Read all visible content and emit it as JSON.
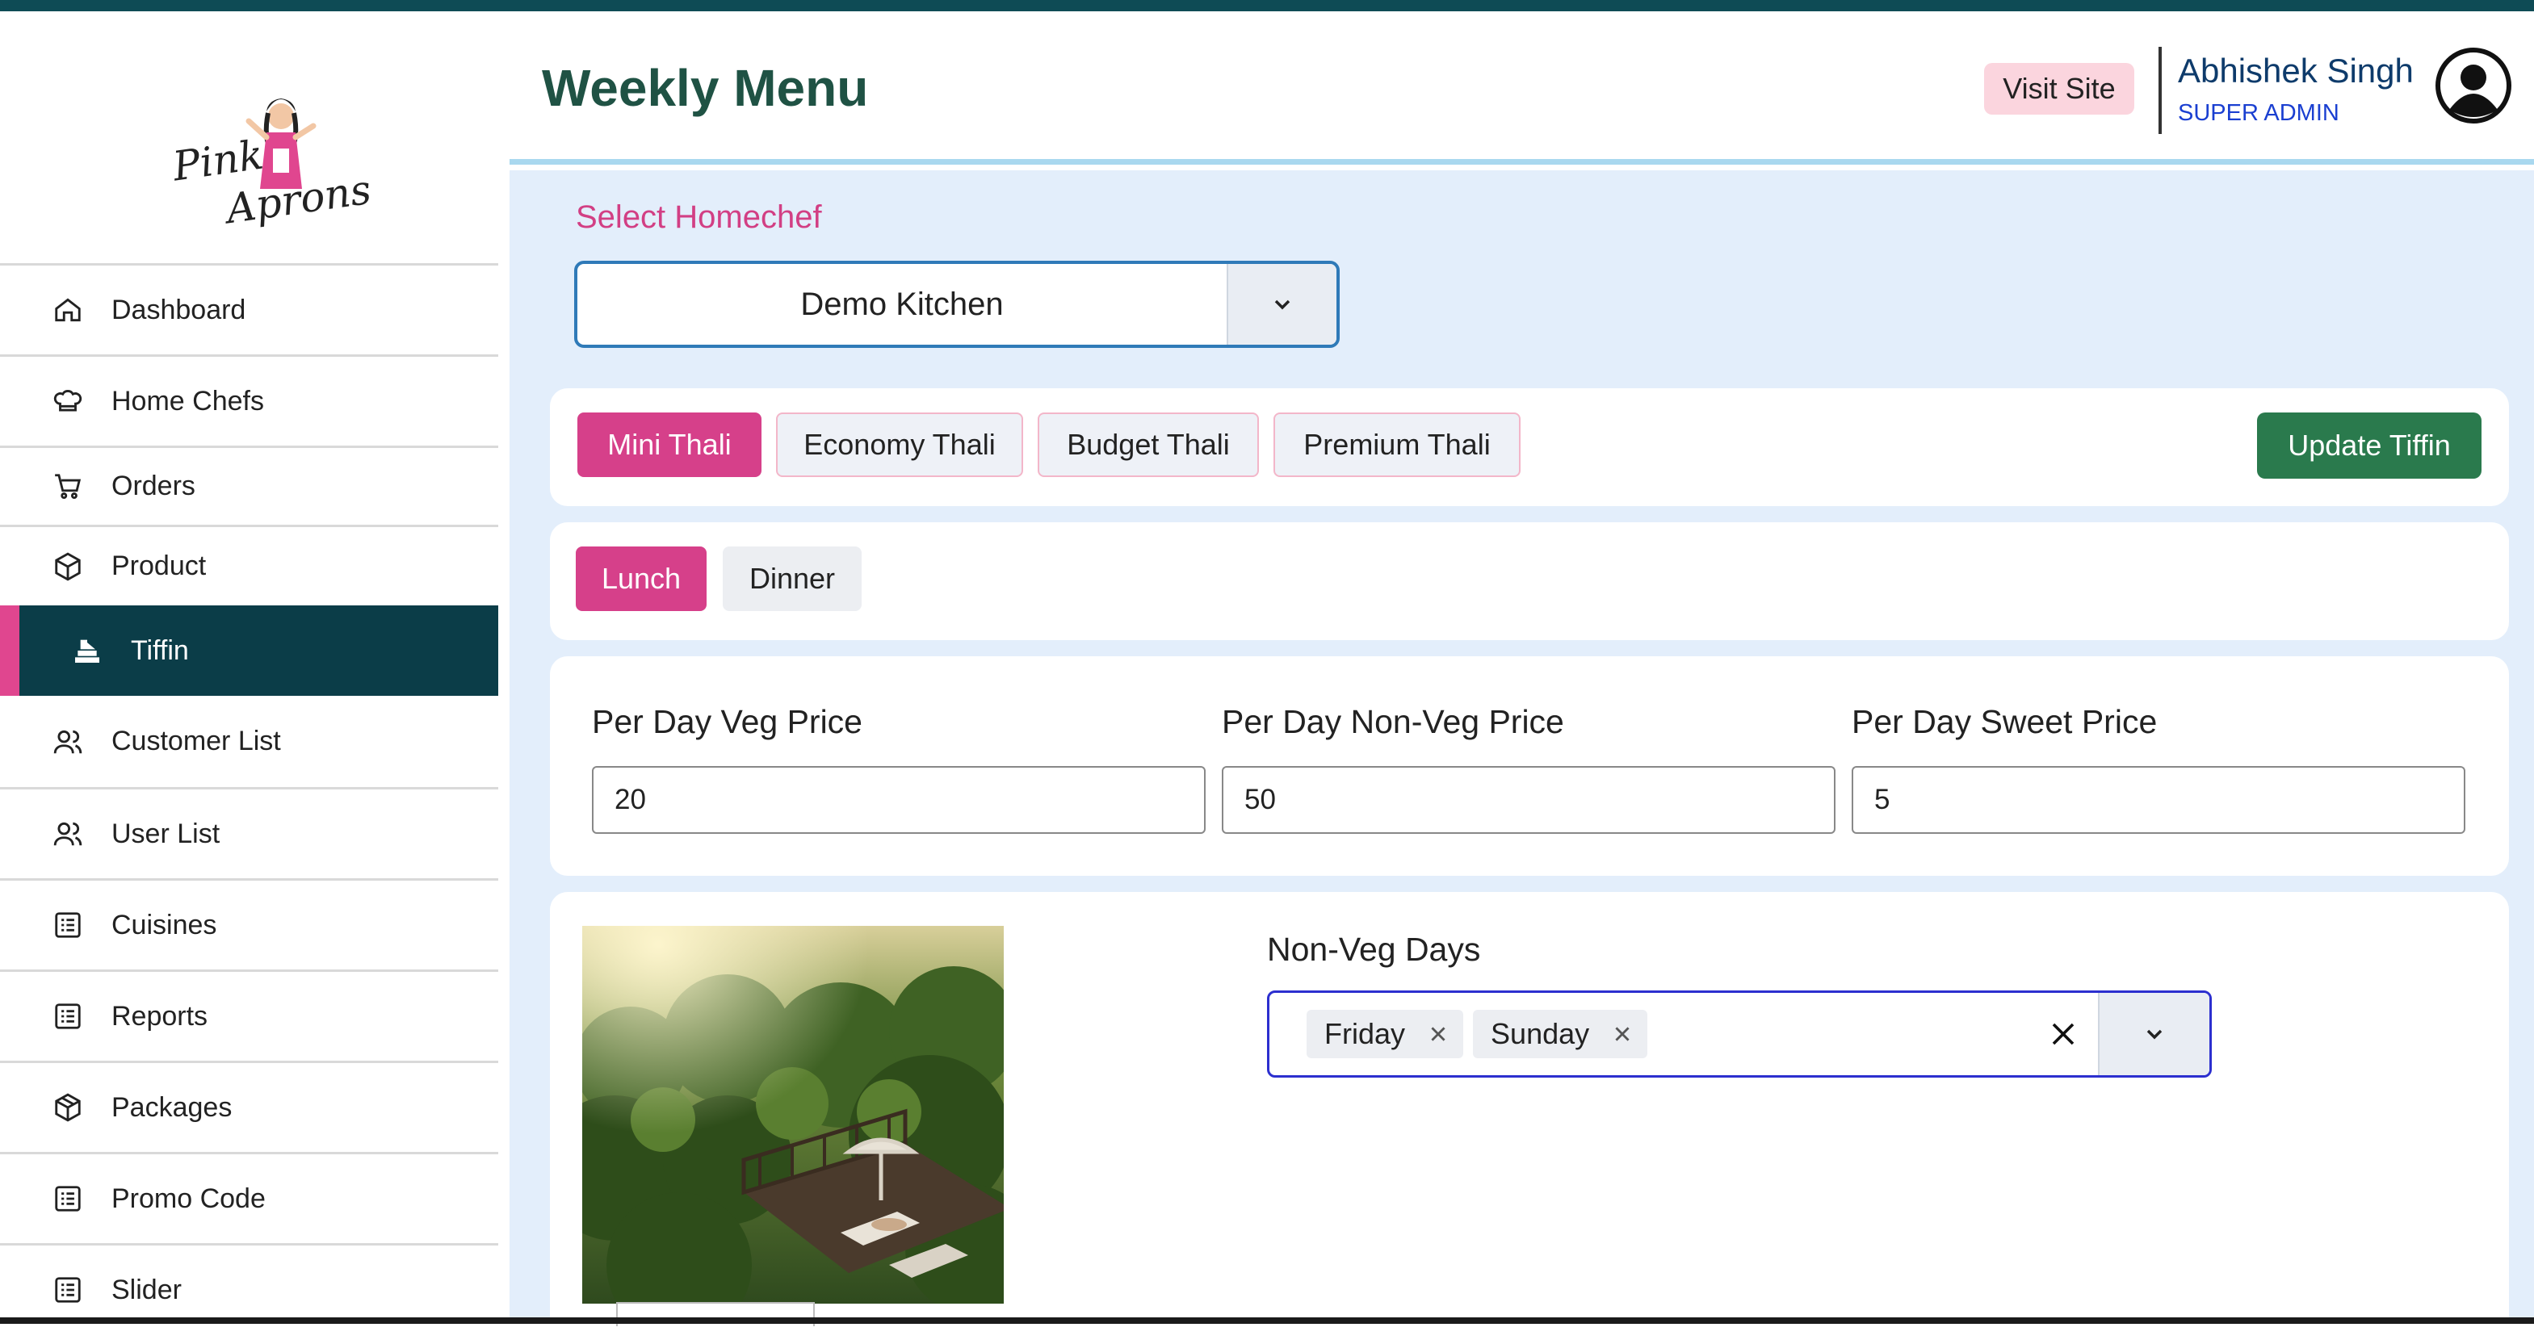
{
  "brand": {
    "logo_line1": "Pink",
    "logo_line2": "Aprons"
  },
  "sidebar": {
    "items": [
      {
        "label": "Dashboard",
        "icon": "home-icon"
      },
      {
        "label": "Home Chefs",
        "icon": "chef-hat-icon"
      },
      {
        "label": "Orders",
        "icon": "cart-icon"
      },
      {
        "label": "Product",
        "icon": "box-icon"
      },
      {
        "label": "Tiffin",
        "icon": "tiffin-icon",
        "active": true
      },
      {
        "label": "Customer List",
        "icon": "users-icon"
      },
      {
        "label": "User List",
        "icon": "users-icon"
      },
      {
        "label": "Cuisines",
        "icon": "list-icon"
      },
      {
        "label": "Reports",
        "icon": "list-icon"
      },
      {
        "label": "Packages",
        "icon": "package-icon"
      },
      {
        "label": "Promo Code",
        "icon": "list-icon"
      },
      {
        "label": "Slider",
        "icon": "list-icon"
      }
    ]
  },
  "header": {
    "title": "Weekly Menu",
    "visit_site": "Visit Site",
    "user_name": "Abhishek Singh",
    "user_role": "SUPER ADMIN"
  },
  "homechef": {
    "label": "Select Homechef",
    "value": "Demo Kitchen"
  },
  "thali_tabs": [
    "Mini Thali",
    "Economy Thali",
    "Budget Thali",
    "Premium Thali"
  ],
  "update_button": "Update Tiffin",
  "meal_tabs": [
    "Lunch",
    "Dinner"
  ],
  "prices": [
    {
      "label": "Per Day Veg Price",
      "value": "20"
    },
    {
      "label": "Per Day Non-Veg Price",
      "value": "50"
    },
    {
      "label": "Per Day Sweet Price",
      "value": "5"
    }
  ],
  "non_veg": {
    "label": "Non-Veg Days",
    "selected": [
      "Friday",
      "Sunday"
    ]
  },
  "colors": {
    "accent": "#d6408a",
    "sidebar_active": "#0b3d48",
    "primary_green": "#2a7a4d",
    "content_bg": "#e3eefb"
  }
}
